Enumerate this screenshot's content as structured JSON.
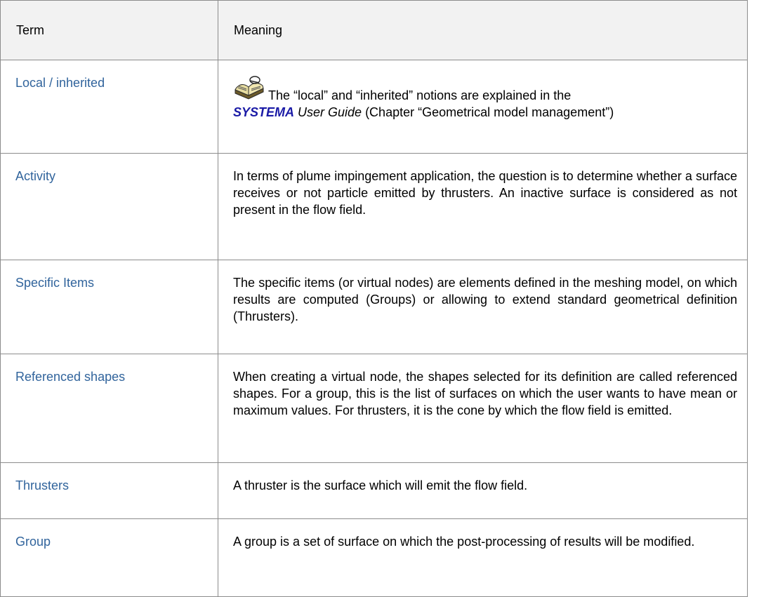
{
  "header": {
    "term": "Term",
    "meaning": "Meaning"
  },
  "rows": [
    {
      "term": "Local / inherited",
      "meaning_parts": {
        "line1": "The “local” and “inherited” notions are explained in the",
        "brand": "SYSTEMA",
        "guide": " User Guide",
        "rest": " (Chapter  “Geometrical model management”)"
      },
      "icon": "open-book-icon"
    },
    {
      "term": "Activity",
      "meaning": "In terms of plume impingement application, the question is to determine whether a surface receives or not particle emitted by thrusters. An inactive surface is considered as not present in the flow field."
    },
    {
      "term": "Specific Items",
      "meaning": "The specific items (or virtual nodes) are elements defined in the meshing model, on which results are computed (Groups) or allowing to extend standard geometrical definition (Thrusters)."
    },
    {
      "term": "Referenced shapes",
      "meaning": "When creating a virtual node, the shapes selected for its definition are called referenced shapes. For a group, this is the list of surfaces on which the user wants to have mean or maximum values. For thrusters, it is the cone by which the flow field is emitted."
    },
    {
      "term": "Thrusters",
      "meaning": "A thruster is the surface which will emit the flow field."
    },
    {
      "term": "Group",
      "meaning": "A group is a set of surface on which the post-processing of results will be modified."
    }
  ],
  "colors": {
    "term_text": "#31649c",
    "brand_text": "#1a1aa6",
    "header_bg": "#f2f2f2",
    "border": "#8c8c8c"
  }
}
